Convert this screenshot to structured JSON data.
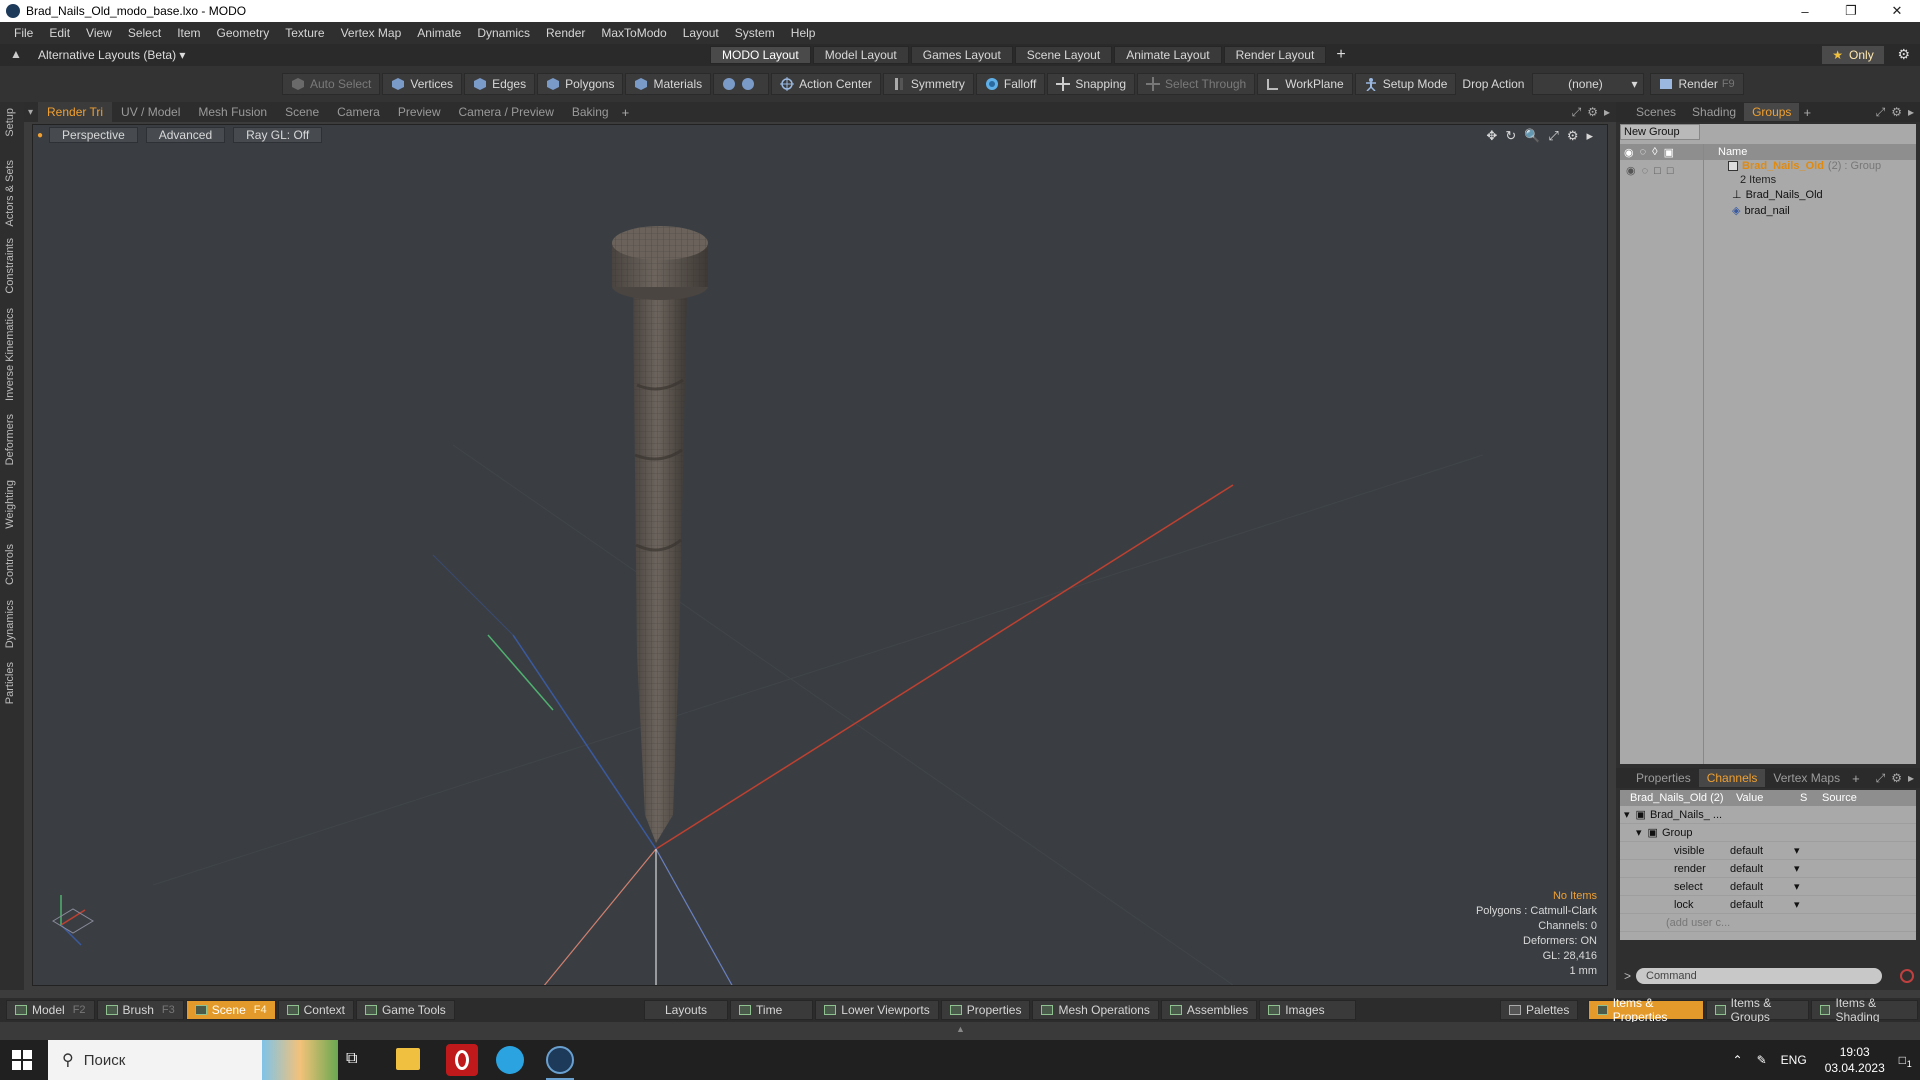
{
  "window": {
    "title": "Brad_Nails_Old_modo_base.lxo - MODO",
    "controls": [
      "–",
      "❐",
      "✕"
    ]
  },
  "menu": [
    "File",
    "Edit",
    "View",
    "Select",
    "Item",
    "Geometry",
    "Texture",
    "Vertex Map",
    "Animate",
    "Dynamics",
    "Render",
    "MaxToModo",
    "Layout",
    "System",
    "Help"
  ],
  "layoutbar": {
    "alt_layouts": "Alternative Layouts (Beta)",
    "tabs": [
      "MODO Layout",
      "Model Layout",
      "Games Layout",
      "Scene Layout",
      "Animate Layout",
      "Render Layout"
    ],
    "active_tab": "MODO Layout",
    "only_label": "Only"
  },
  "toolbar": {
    "auto_select": "Auto Select",
    "vertices": "Vertices",
    "edges": "Edges",
    "polygons": "Polygons",
    "materials": "Materials",
    "action_center": "Action Center",
    "symmetry": "Symmetry",
    "falloff": "Falloff",
    "snapping": "Snapping",
    "select_through": "Select Through",
    "workplane": "WorkPlane",
    "setup_mode": "Setup Mode",
    "drop_action": "Drop Action",
    "drop_value": "(none)",
    "render": "Render",
    "render_key": "F9"
  },
  "left_strip": [
    "Setup",
    "Actors & Sets",
    "Constraints",
    "Inverse Kinematics",
    "Deformers",
    "Weighting",
    "Controls",
    "Dynamics",
    "Particles"
  ],
  "viewport_tabs": [
    "Render Tri",
    "UV / Model",
    "Mesh Fusion",
    "Scene",
    "Camera",
    "Preview",
    "Camera / Preview",
    "Baking"
  ],
  "viewport": {
    "projection": "Perspective",
    "advanced": "Advanced",
    "raygl": "Ray GL: Off",
    "info": {
      "no_items": "No Items",
      "polygons": "Polygons : Catmull-Clark",
      "channels": "Channels: 0",
      "deformers": "Deformers: ON",
      "gl": "GL: 28,416",
      "scale": "1 mm"
    }
  },
  "right_top_tabs": [
    "Scenes",
    "Shading",
    "Groups"
  ],
  "groups": {
    "new_group": "New Group",
    "name_header": "Name",
    "group_name": "Brad_Nails_Old",
    "group_suffix": "(2) : Group",
    "group_count": "2 Items",
    "children": [
      "Brad_Nails_Old",
      "brad_nail"
    ]
  },
  "right_bottom_tabs": [
    "Properties",
    "Channels",
    "Vertex Maps"
  ],
  "channels": {
    "header_item": "Brad_Nails_Old (2)",
    "header_value": "Value",
    "header_s": "S",
    "header_source": "Source",
    "item": "Brad_Nails_ ...",
    "group": "Group",
    "rows": [
      {
        "name": "visible",
        "value": "default"
      },
      {
        "name": "render",
        "value": "default"
      },
      {
        "name": "select",
        "value": "default"
      },
      {
        "name": "lock",
        "value": "default"
      }
    ],
    "add_user": "(add user c..."
  },
  "command": {
    "placeholder": "Command"
  },
  "bottombar": {
    "left": [
      {
        "label": "Model",
        "key": "F2"
      },
      {
        "label": "Brush",
        "key": "F3"
      },
      {
        "label": "Scene",
        "key": "F4"
      },
      {
        "label": "Context",
        "key": ""
      },
      {
        "label": "Game Tools",
        "key": ""
      }
    ],
    "center": [
      "Layouts",
      "Time",
      "Lower Viewports",
      "Properties",
      "Mesh Operations",
      "Assemblies",
      "Images"
    ],
    "right": [
      "Palettes",
      "Items & Properties",
      "Items & Groups",
      "Items & Shading"
    ]
  },
  "taskbar": {
    "search": "Поиск",
    "lang": "ENG",
    "time": "19:03",
    "date": "03.04.2023",
    "notif": "1"
  },
  "colors": {
    "accent": "#f0a030",
    "viewport_bg": "#3a3e42",
    "nail": "#5e5650"
  }
}
